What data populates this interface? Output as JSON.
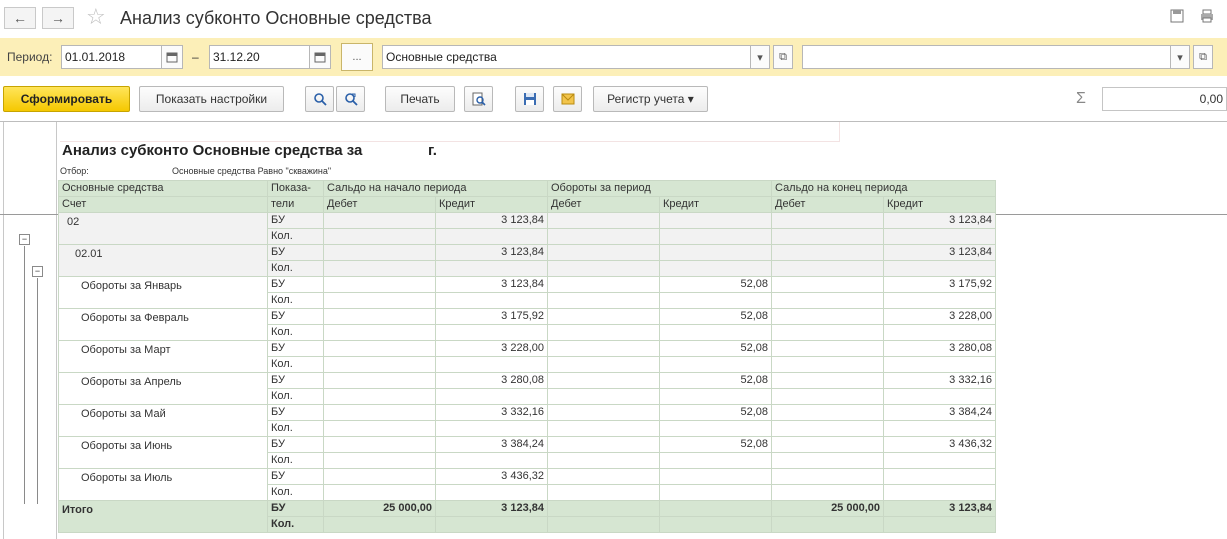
{
  "window": {
    "title": "Анализ субконто Основные средства",
    "back_icon": "←",
    "forward_icon": "→",
    "star_icon": "☆"
  },
  "period": {
    "label": "Период:",
    "from": "01.01.2018",
    "to": "31.12.20",
    "dash": "–",
    "more_button": "...",
    "subconto": "Основные средства",
    "subconto2": ""
  },
  "toolbar": {
    "generate": "Сформировать",
    "show_settings": "Показать настройки",
    "print": "Печать",
    "register": "Регистр учета",
    "sum_value": "0,00",
    "sigma": "Σ"
  },
  "report": {
    "title": "Анализ субконто Основные средства за",
    "title_suffix": "г.",
    "filter_label": "Отбор:",
    "filter_value": "Основные средства Равно \"скважина\"",
    "headers": {
      "col1_top": "Основные средства",
      "col1_bottom": "Счет",
      "col2_top": "Показа-",
      "col2_bottom": "тели",
      "start": "Сальдо на начало периода",
      "turnover": "Обороты за период",
      "end": "Сальдо на конец периода",
      "debit": "Дебет",
      "credit": "Кредит"
    },
    "rows": [
      {
        "name": "02",
        "ind1": "БУ",
        "ind2": "Кол.",
        "sd": "",
        "sc": "3 123,84",
        "td": "",
        "tc": "",
        "ed": "",
        "ec": "3 123,84",
        "group": true
      },
      {
        "name": "02.01",
        "ind1": "БУ",
        "ind2": "Кол.",
        "sd": "",
        "sc": "3 123,84",
        "td": "",
        "tc": "",
        "ed": "",
        "ec": "3 123,84",
        "group": true
      },
      {
        "name": "Обороты за Январь",
        "ind1": "БУ",
        "ind2": "Кол.",
        "sd": "",
        "sc": "3 123,84",
        "td": "",
        "tc": "52,08",
        "ed": "",
        "ec": "3 175,92",
        "group": false
      },
      {
        "name": "Обороты за Февраль",
        "ind1": "БУ",
        "ind2": "Кол.",
        "sd": "",
        "sc": "3 175,92",
        "td": "",
        "tc": "52,08",
        "ed": "",
        "ec": "3 228,00",
        "group": false
      },
      {
        "name": "Обороты за Март",
        "ind1": "БУ",
        "ind2": "Кол.",
        "sd": "",
        "sc": "3 228,00",
        "td": "",
        "tc": "52,08",
        "ed": "",
        "ec": "3 280,08",
        "group": false
      },
      {
        "name": "Обороты за Апрель",
        "ind1": "БУ",
        "ind2": "Кол.",
        "sd": "",
        "sc": "3 280,08",
        "td": "",
        "tc": "52,08",
        "ed": "",
        "ec": "3 332,16",
        "group": false
      },
      {
        "name": "Обороты за Май",
        "ind1": "БУ",
        "ind2": "Кол.",
        "sd": "",
        "sc": "3 332,16",
        "td": "",
        "tc": "52,08",
        "ed": "",
        "ec": "3 384,24",
        "group": false
      },
      {
        "name": "Обороты за Июнь",
        "ind1": "БУ",
        "ind2": "Кол.",
        "sd": "",
        "sc": "3 384,24",
        "td": "",
        "tc": "52,08",
        "ed": "",
        "ec": "3 436,32",
        "group": false
      },
      {
        "name": "Обороты за Июль",
        "ind1": "БУ",
        "ind2": "Кол.",
        "sd": "",
        "sc": "3 436,32",
        "td": "",
        "tc": "",
        "ed": "",
        "ec": "",
        "group": false
      }
    ],
    "total": {
      "name": "Итого",
      "ind1": "БУ",
      "ind2": "Кол.",
      "sd": "25 000,00",
      "sc": "3 123,84",
      "td": "",
      "tc": "",
      "ed": "25 000,00",
      "ec": "3 123,84"
    }
  }
}
